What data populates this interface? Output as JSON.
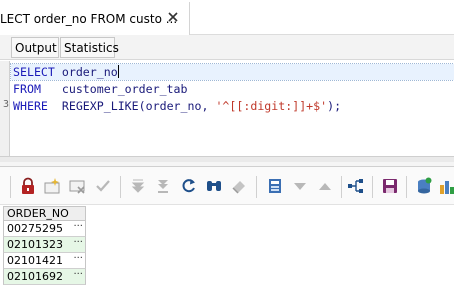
{
  "tab": {
    "title": "LECT order_no FROM custo ...",
    "close_icon": "close-icon"
  },
  "subtabs": {
    "output": "Output",
    "statistics": "Statistics"
  },
  "editor": {
    "line_numbers": [
      "",
      "",
      "3"
    ],
    "lines": [
      {
        "keyword": "SELECT",
        "rest": " order_no"
      },
      {
        "keyword": "FROM",
        "rest": "   customer_order_tab"
      },
      {
        "keyword": "WHERE",
        "rest": "  REGEXP_LIKE(order_no, ",
        "string": "'^[[:digit:]]+$'",
        "tail": ");"
      }
    ]
  },
  "toolbar": {
    "icons": [
      "lock-icon",
      "new-record-icon",
      "delete-record-icon",
      "post-edit-icon",
      "move-first-icon",
      "move-last-icon",
      "refresh-icon",
      "find-icon",
      "clear-icon",
      "grid-view-icon",
      "sort-descending-icon",
      "sort-ascending-icon",
      "tree-icon",
      "save-icon",
      "export-icon",
      "chart-icon"
    ],
    "accent_color": "#1e4f8a",
    "save_color": "#7b2a6e"
  },
  "grid": {
    "columns": [
      "ORDER_NO"
    ],
    "rows": [
      "00275295",
      "02101323",
      "02101421",
      "02101692"
    ],
    "cell_button": "···"
  }
}
